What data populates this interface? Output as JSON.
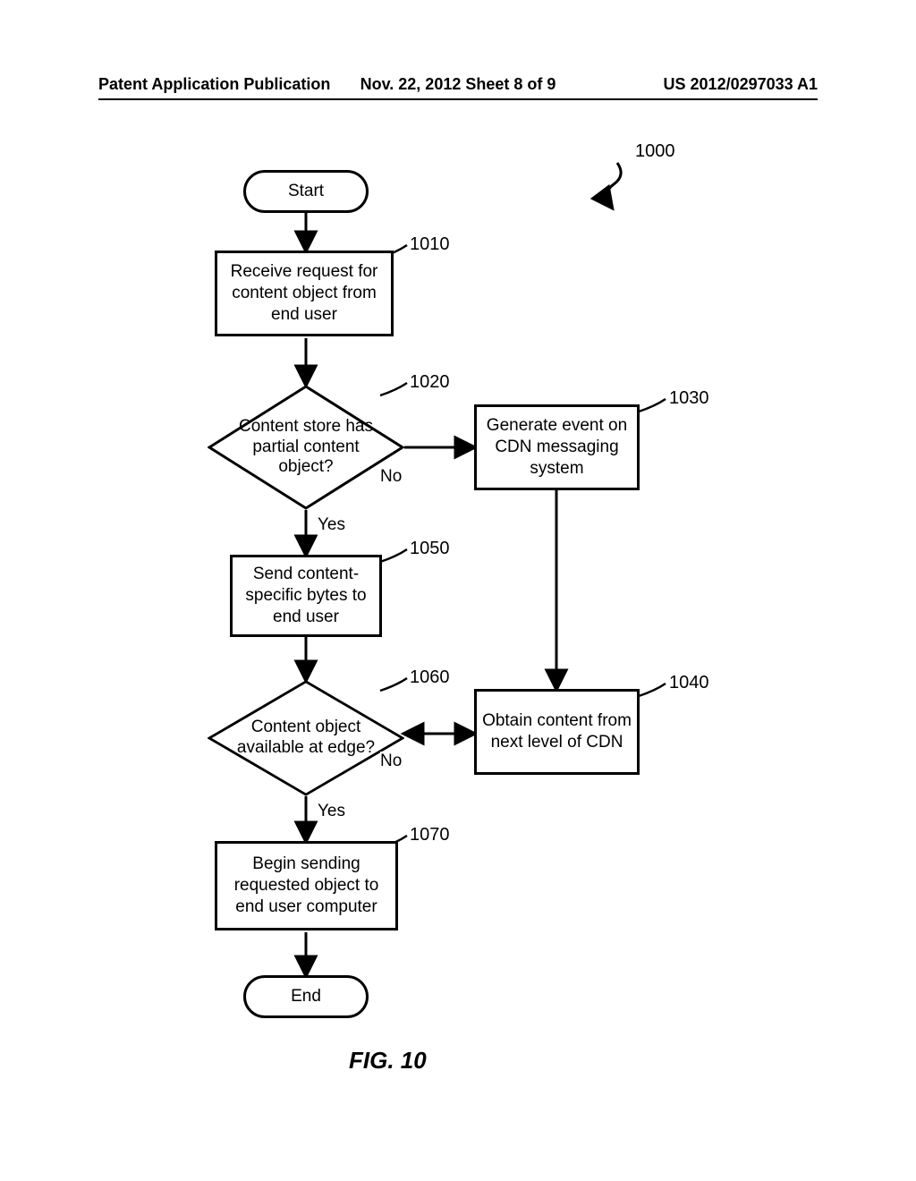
{
  "header": {
    "left": "Patent Application Publication",
    "mid": "Nov. 22, 2012   Sheet 8 of 9",
    "right": "US 2012/0297033 A1"
  },
  "figure": {
    "title": "FIG. 10",
    "overall_ref": "1000",
    "nodes": {
      "start": {
        "label": "Start"
      },
      "n1010": {
        "label": "Receive request for content object from end user",
        "ref": "1010"
      },
      "n1020": {
        "label": "Content store has partial content object?",
        "ref": "1020"
      },
      "n1030": {
        "label": "Generate event on CDN messaging system",
        "ref": "1030"
      },
      "n1050": {
        "label": "Send content-specific bytes to end user",
        "ref": "1050"
      },
      "n1060": {
        "label": "Content object available at edge?",
        "ref": "1060"
      },
      "n1040": {
        "label": "Obtain content from next level of CDN",
        "ref": "1040"
      },
      "n1070": {
        "label": "Begin sending requested object to end user computer",
        "ref": "1070"
      },
      "end": {
        "label": "End"
      }
    },
    "edges": {
      "yes1": "Yes",
      "no1": "No",
      "yes2": "Yes",
      "no2": "No"
    }
  }
}
